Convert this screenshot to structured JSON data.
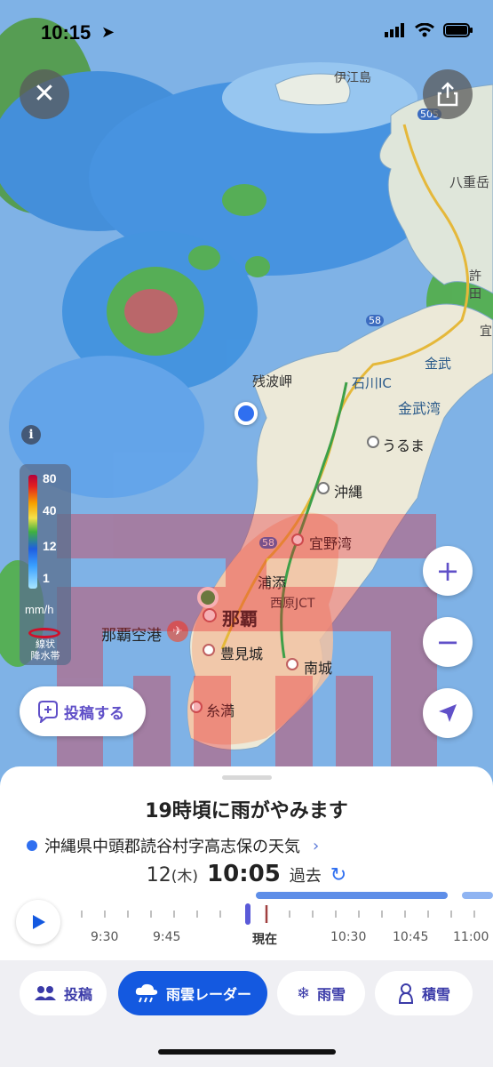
{
  "status": {
    "time": "10:15"
  },
  "map": {
    "places": {
      "iejima": "伊江島",
      "yaedake": "八重岳",
      "kyoda": "許田",
      "gushikawa": "宜",
      "kin": "金武",
      "ishikawa_ic": "石川IC",
      "kin_bay": "金武湾",
      "zampa": "残波岬",
      "uruma": "うるま",
      "okinawa": "沖縄",
      "ginowan": "宜野湾",
      "urasoe": "浦添",
      "nishihara_jct": "西原JCT",
      "naha": "那覇",
      "naha_airport": "那覇空港",
      "tomigusuku": "豊見城",
      "nanjo": "南城",
      "itoman": "糸満",
      "route_58": "58",
      "route_58b": "58",
      "route_505": "505"
    },
    "overlay_char": "雨"
  },
  "legend": {
    "values": [
      "80",
      "40",
      "12",
      "1"
    ],
    "unit": "mm/h",
    "band_label_1": "線状",
    "band_label_2": "降水帯"
  },
  "post_button_label": "投稿する",
  "sheet": {
    "forecast": "19時頃に雨がやみます",
    "location": "沖縄県中頭郡読谷村字高志保の天気",
    "date": "12",
    "weekday": "(木)",
    "time": "10:05",
    "mode": "過去",
    "timeline_labels": [
      "9:30",
      "9:45",
      "現在",
      "10:30",
      "10:45",
      "11:00"
    ]
  },
  "tabs": [
    {
      "label": "投稿",
      "icon": "people-icon"
    },
    {
      "label": "雨雲レーダー",
      "icon": "rain-cloud-icon"
    },
    {
      "label": "雨雪",
      "icon": "snow-rain-icon"
    },
    {
      "label": "積雪",
      "icon": "snowman-icon"
    }
  ],
  "colors": {
    "accent": "#1459e0",
    "rain_overlay": "#e8202a",
    "purple": "#6050c8"
  }
}
